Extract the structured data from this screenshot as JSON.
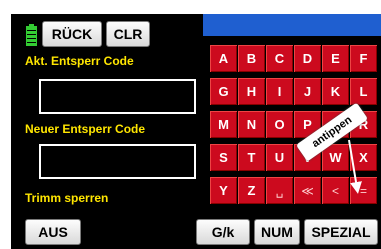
{
  "header": {
    "back_label": "RÜCK",
    "clear_label": "CLR"
  },
  "current_code": {
    "label": "Akt. Entsperr Code",
    "value": ""
  },
  "new_code": {
    "label": "Neuer Entsperr Code",
    "value": ""
  },
  "trim_lock": {
    "label": "Trimm sperren",
    "value": "AUS"
  },
  "keypad": {
    "rows": [
      [
        "A",
        "B",
        "C",
        "D",
        "E",
        "F"
      ],
      [
        "G",
        "H",
        "I",
        "J",
        "K",
        "L"
      ],
      [
        "M",
        "N",
        "O",
        "P",
        "Q",
        "R"
      ],
      [
        "S",
        "T",
        "U",
        "V",
        "W",
        "X"
      ],
      [
        "Y",
        "Z",
        "␣",
        "≪",
        "<",
        "="
      ]
    ],
    "tap_hint": "antippen"
  },
  "footer": {
    "case_label": "G/k",
    "num_label": "NUM",
    "special_label": "SPEZIAL"
  },
  "colors": {
    "key_red": "#cc0a1e",
    "label_yellow": "#ffe600",
    "top_bar_blue": "#1f5fd0",
    "battery_green": "#33cc33"
  }
}
